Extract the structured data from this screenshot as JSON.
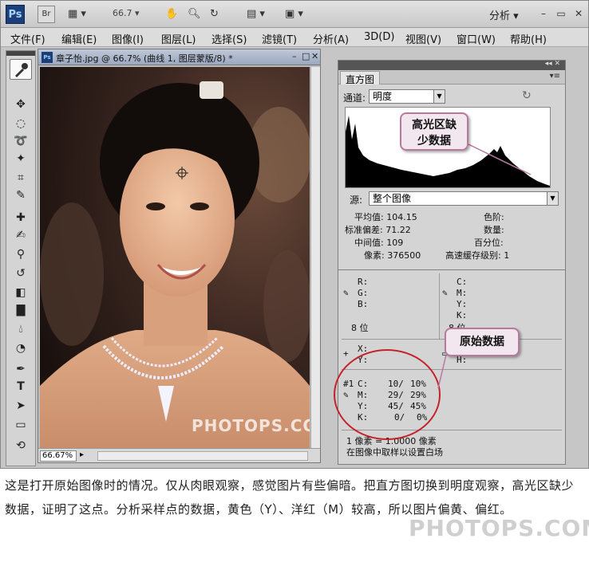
{
  "app": {
    "logo": "Ps",
    "bridge": "Br",
    "zoom_value": "66.7",
    "workspace": "分析",
    "colors": {
      "accent": "#1c3f7a",
      "callout_border": "#b87a9c",
      "ellipse": "#c4222a"
    }
  },
  "menubar": {
    "items": [
      "文件(F)",
      "编辑(E)",
      "图像(I)",
      "图层(L)",
      "选择(S)",
      "滤镜(T)",
      "分析(A)",
      "3D(D)",
      "视图(V)",
      "窗口(W)",
      "帮助(H)"
    ]
  },
  "document": {
    "title": "章子怡.jpg @ 66.7% (曲线 1, 图层蒙版/8) *",
    "zoom_field": "66.67%",
    "photo_watermark": "PHOTOPS.COM"
  },
  "histogram": {
    "tab": "直方图",
    "channel_label": "通道:",
    "channel_value": "明度",
    "source_label": "源:",
    "source_value": "整个图像",
    "stats": {
      "mean_label": "平均值:",
      "mean": "104.15",
      "std_label": "标准偏差:",
      "std": "71.22",
      "median_label": "中间值:",
      "median": "109",
      "pixels_label": "像素:",
      "pixels": "376500",
      "level_label": "色阶:",
      "count_label": "数量:",
      "percentile_label": "百分位:",
      "cache_label": "高速缓存级别:",
      "cache": "1"
    }
  },
  "info": {
    "rgb": [
      "R:",
      "G:",
      "B:"
    ],
    "bit_depth": "8 位",
    "cmyk_right": [
      "C:",
      "M:",
      "Y:",
      "K:"
    ],
    "bit_right": "8 位",
    "xy": [
      "X:",
      "Y:"
    ],
    "wh": [
      "W:",
      "H:"
    ],
    "sample_tag": "#1",
    "sample_rows": [
      {
        "ch": "C:",
        "val": "10/",
        "pct": "10%"
      },
      {
        "ch": "M:",
        "val": "29/",
        "pct": "29%"
      },
      {
        "ch": "Y:",
        "val": "45/",
        "pct": "45%"
      },
      {
        "ch": "K:",
        "val": "0/",
        "pct": "0%"
      }
    ],
    "note_line1": "1 像素 = 1.0000 像素",
    "note_line2": "在图像中取样以设置白场"
  },
  "callouts": {
    "highlight": "高光区缺\n少数据",
    "original": "原始数据"
  },
  "caption": {
    "text": "这是打开原始图像时的情况。仅从肉眼观察，感觉图片有些偏暗。把直方图切换到明度观察，高光区缺少数据，证明了这点。分析采样点的数据，黄色（Y）、洋红（M）较高，所以图片偏黄、偏红。",
    "watermark": "PHOTOPS.COM"
  }
}
